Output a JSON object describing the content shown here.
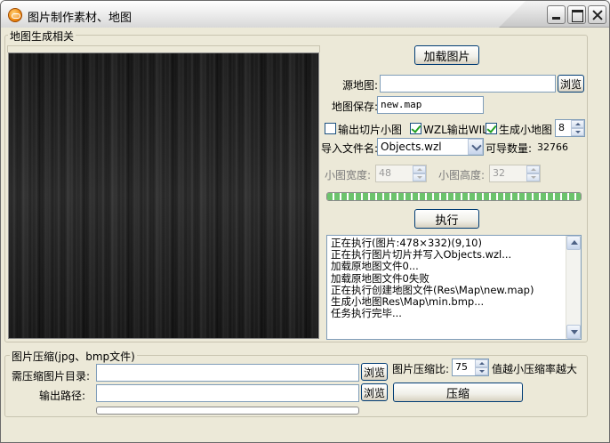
{
  "window": {
    "title": "图片制作素材、地图"
  },
  "map_group": {
    "legend": "地图生成相关",
    "load_button": "加载图片",
    "source_map_label": "源地图:",
    "source_map_value": "",
    "browse_label": "浏览",
    "map_save_label": "地图保存:",
    "map_save_value": "new.map",
    "export_tiles_label": "输出切片小图",
    "export_tiles_checked": false,
    "wzl_output_label": "WZL输出WIL",
    "wzl_output_checked": true,
    "gen_minimap_label": "生成小地图",
    "gen_minimap_checked": true,
    "minimap_level": "8",
    "import_file_label": "导入文件名:",
    "import_file_value": "Objects.wzl",
    "available_count_label": "可导数量:",
    "available_count_value": "32766",
    "tile_width_label": "小图宽度:",
    "tile_width_value": "48",
    "tile_height_label": "小图高度:",
    "tile_height_value": "32",
    "progress": 1.0,
    "execute_button": "执行",
    "log_lines": [
      "正在执行(图片:478×332)(9,10)",
      "正在执行图片切片并写入Objects.wzl...",
      "加载原地图文件0...",
      "加载原地图文件0失败",
      "正在执行创建地图文件(Res\\Map\\new.map)",
      "生成小地图Res\\Map\\min.bmp...",
      "任务执行完毕..."
    ]
  },
  "compress_group": {
    "legend": "图片压缩(jpg、bmp文件)",
    "source_dir_label": "需压缩图片目录:",
    "source_dir_value": "",
    "browse_label": "浏览",
    "output_path_label": "输出路径:",
    "output_path_value": "",
    "browse2_label": "浏览",
    "ratio_label": "图片压缩比:",
    "ratio_value": "75",
    "ratio_hint": "值越小压缩率越大",
    "compress_button": "压缩",
    "progress": 0.0
  },
  "colors": {
    "accent_progress": "#6cc36c",
    "window_bg": "#ece9d8"
  }
}
